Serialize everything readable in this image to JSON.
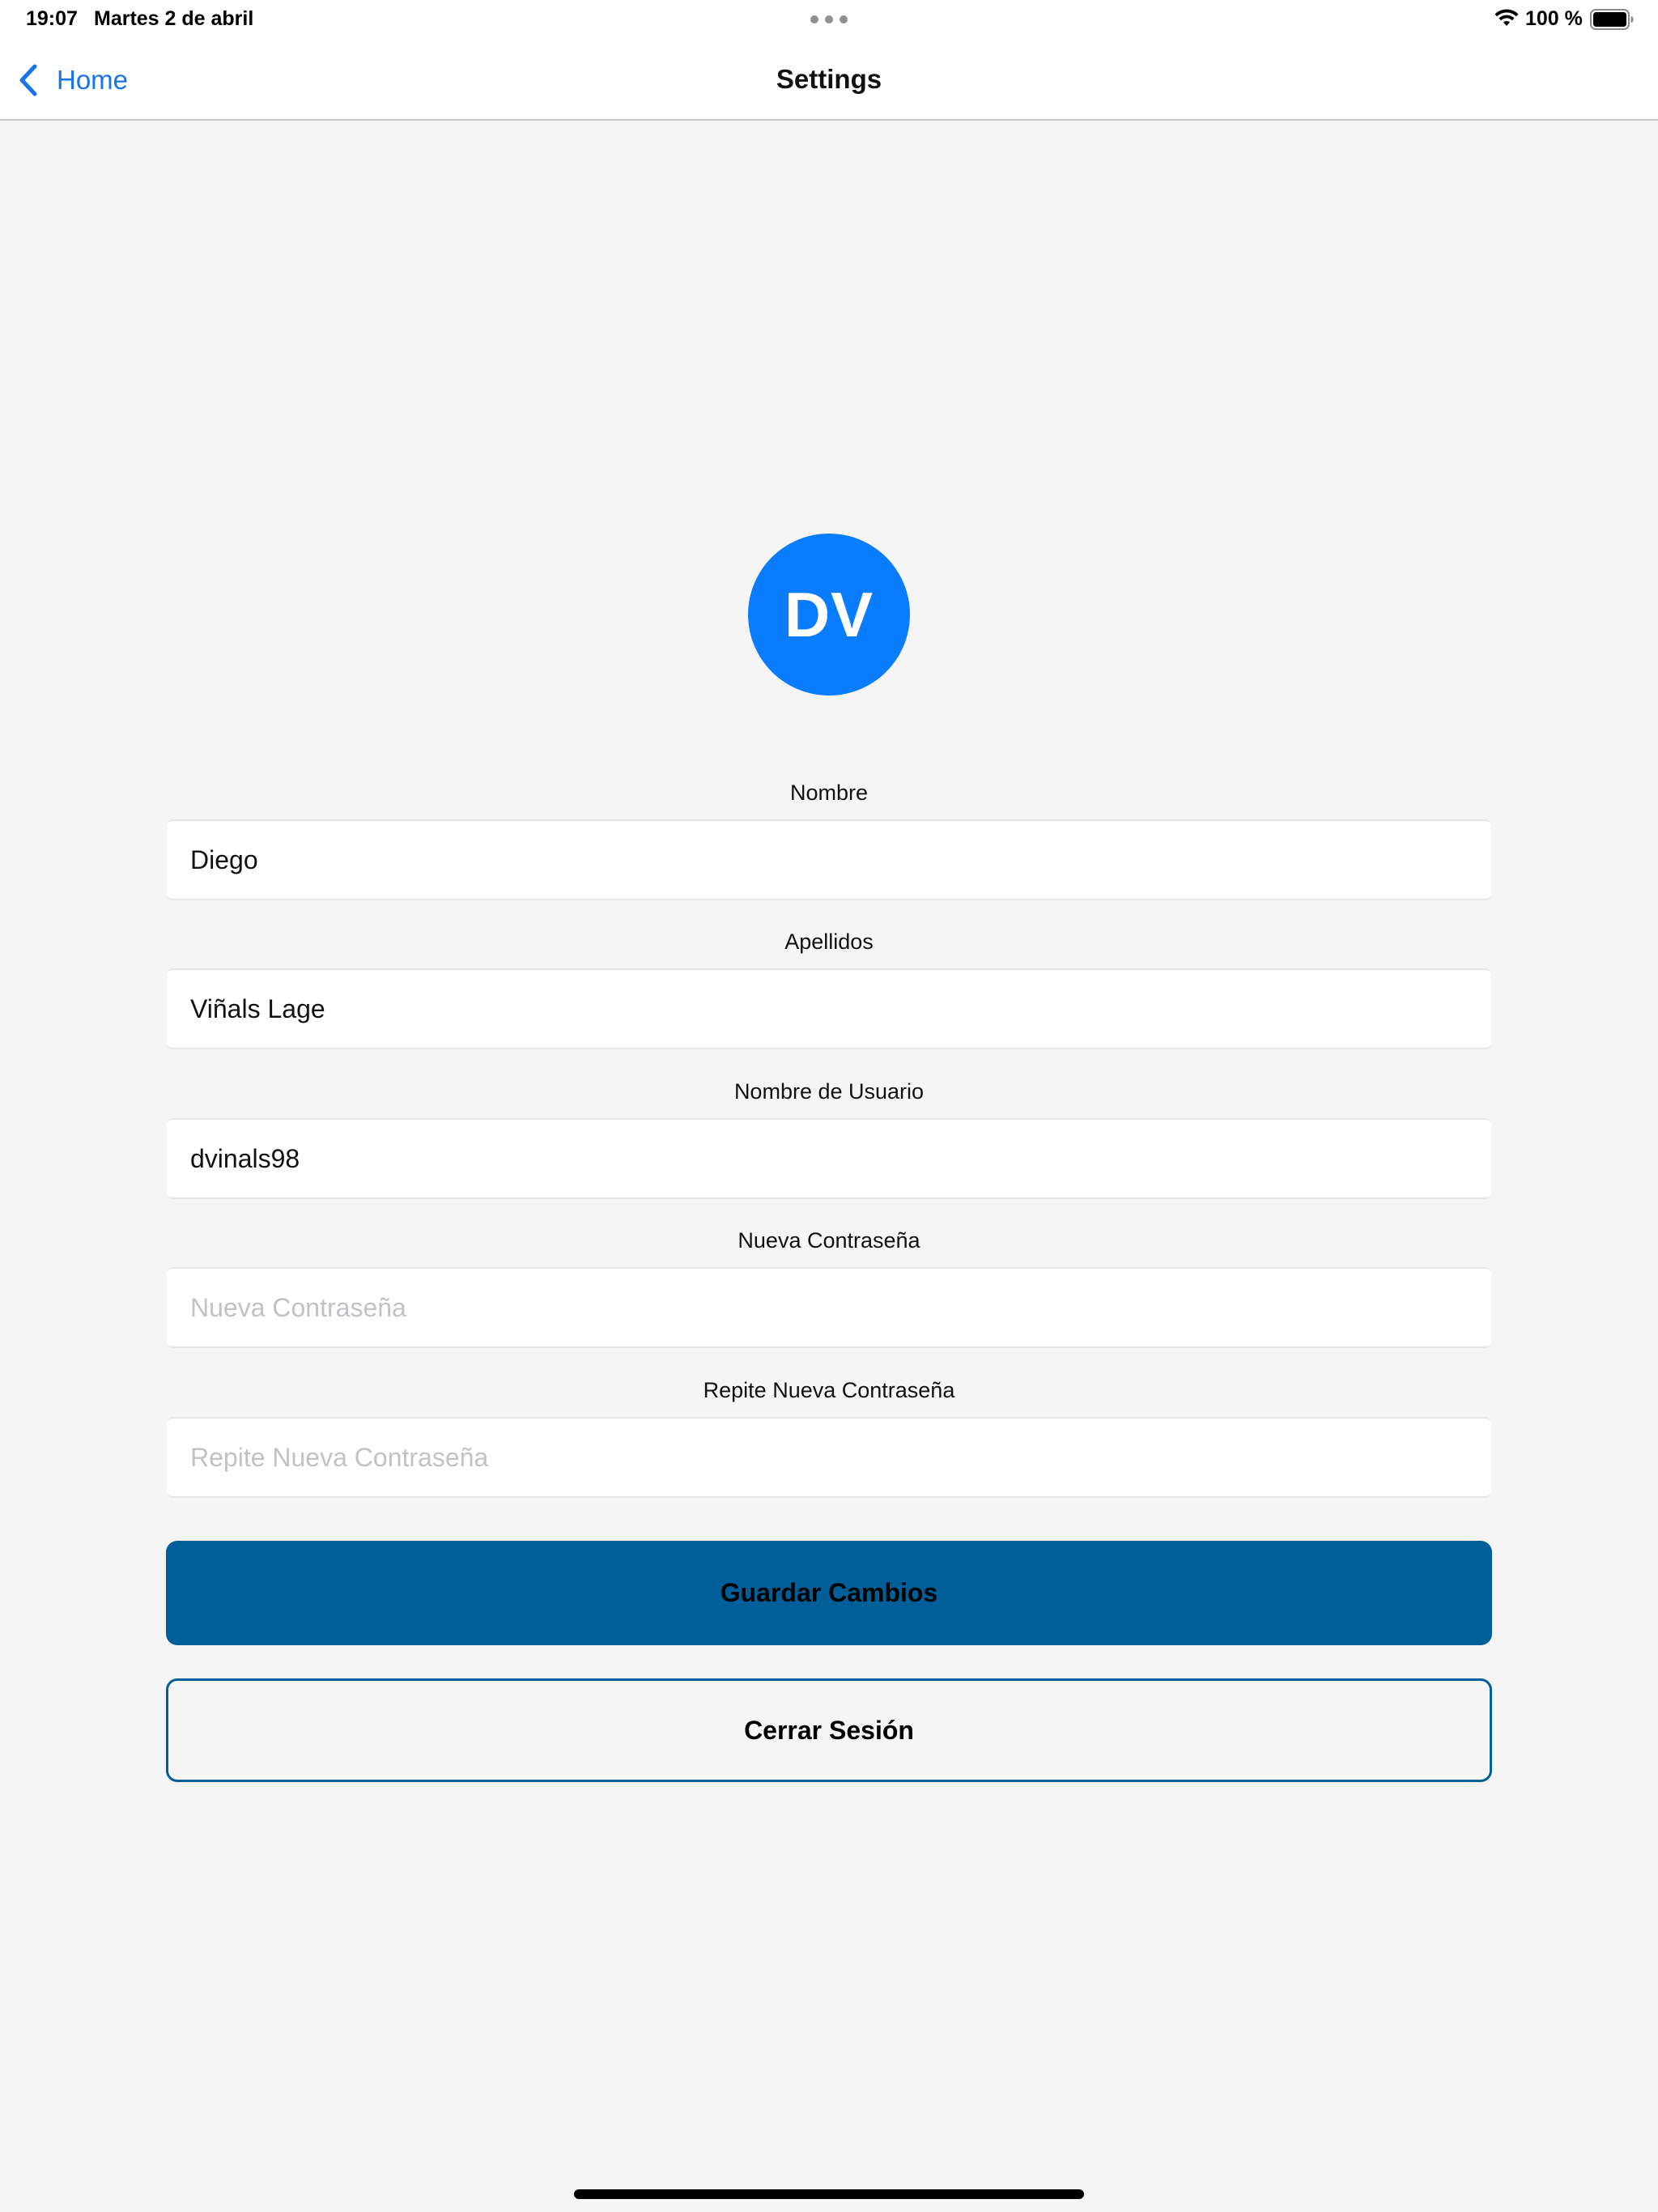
{
  "status_bar": {
    "time": "19:07",
    "date": "Martes 2 de abril",
    "battery_percent": "100 %"
  },
  "nav": {
    "back_label": "Home",
    "title": "Settings"
  },
  "profile": {
    "initials": "DV",
    "avatar_color": "#0a7cff"
  },
  "form": {
    "nombre": {
      "label": "Nombre",
      "value": "Diego",
      "placeholder": ""
    },
    "apellidos": {
      "label": "Apellidos",
      "value": "Viñals Lage",
      "placeholder": ""
    },
    "usuario": {
      "label": "Nombre de Usuario",
      "value": "dvinals98",
      "placeholder": ""
    },
    "nueva_contrasena": {
      "label": "Nueva Contraseña",
      "value": "",
      "placeholder": "Nueva Contraseña"
    },
    "repite_contrasena": {
      "label": "Repite Nueva Contraseña",
      "value": "",
      "placeholder": "Repite Nueva Contraseña"
    }
  },
  "actions": {
    "save_label": "Guardar Cambios",
    "logout_label": "Cerrar Sesión",
    "primary_color": "#005f99"
  },
  "icons": {
    "back": "chevron-left-icon",
    "wifi": "wifi-icon",
    "battery": "battery-icon",
    "multitask": "multitask-dots-icon"
  }
}
